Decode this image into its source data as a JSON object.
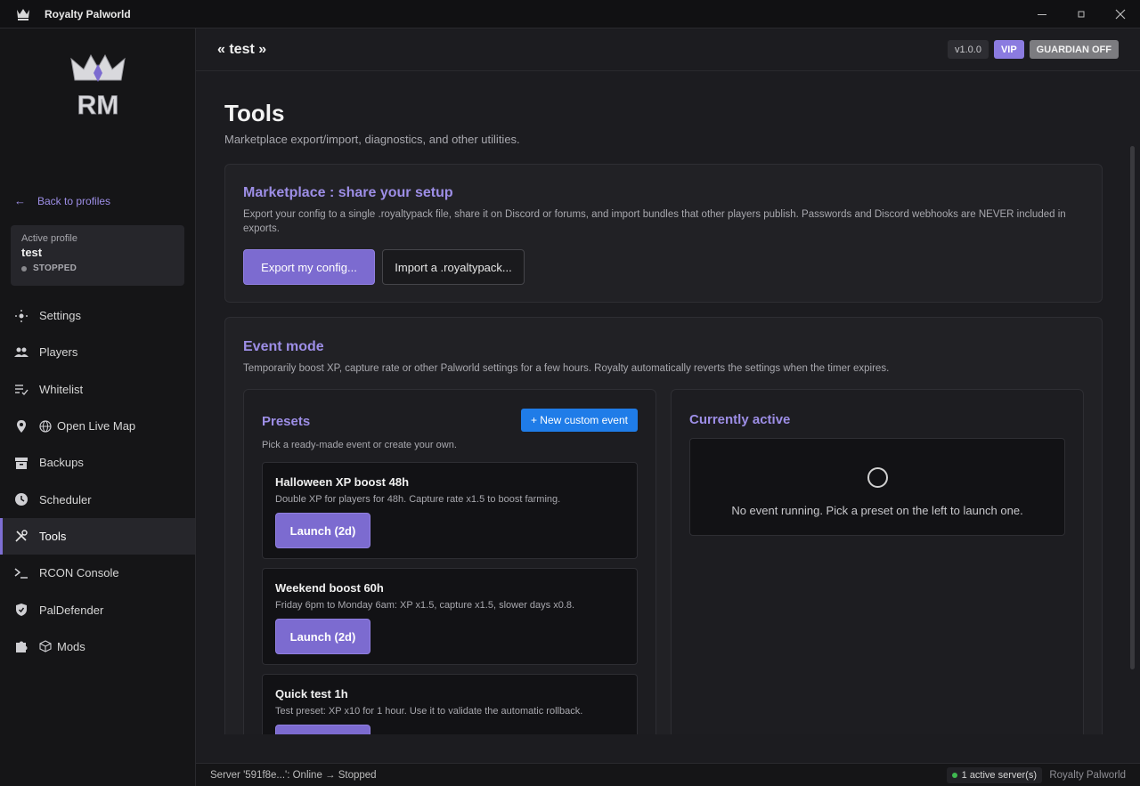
{
  "window": {
    "title": "Royalty Palworld",
    "controls": [
      "minimize-icon",
      "maximize-icon",
      "close-icon"
    ]
  },
  "sidebar": {
    "logo_text": "RM",
    "back_label": "Back to profiles",
    "profile": {
      "label": "Active profile",
      "name": "test",
      "status": "STOPPED"
    },
    "items": [
      {
        "label": "Settings",
        "icon": "settings-icon"
      },
      {
        "label": "Players",
        "icon": "users-icon"
      },
      {
        "label": "Whitelist",
        "icon": "checklist-icon"
      },
      {
        "label": "Open Live Map",
        "icon": "map-pin-icon"
      },
      {
        "label": "Backups",
        "icon": "archive-icon"
      },
      {
        "label": "Scheduler",
        "icon": "clock-icon"
      },
      {
        "label": "Tools",
        "icon": "tools-icon",
        "active": true
      },
      {
        "label": "RCON Console",
        "icon": "terminal-icon"
      },
      {
        "label": "PalDefender",
        "icon": "shield-icon"
      },
      {
        "label": "Mods",
        "icon": "puzzle-icon"
      }
    ]
  },
  "header": {
    "title": "« test »",
    "version": "v1.0.0",
    "vip": "VIP",
    "guardian": "GUARDIAN OFF"
  },
  "page": {
    "title": "Tools",
    "subtitle": "Marketplace export/import, diagnostics, and other utilities."
  },
  "marketplace": {
    "title": "Marketplace : share your setup",
    "description": "Export your config to a single .royaltypack file, share it on Discord or forums, and import bundles that other players publish. Passwords and Discord webhooks are NEVER included in exports.",
    "export_label": "Export my config...",
    "import_label": "Import a .royaltypack..."
  },
  "event_mode": {
    "title": "Event mode",
    "description": "Temporarily boost XP, capture rate or other Palworld settings for a few hours. Royalty automatically reverts the settings when the timer expires.",
    "presets": {
      "title": "Presets",
      "new_label": "+ New custom event",
      "hint": "Pick a ready-made event or create your own.",
      "items": [
        {
          "name": "Halloween XP boost 48h",
          "description": "Double XP for players for 48h. Capture rate x1.5 to boost farming.",
          "launch_label": "Launch (2d)"
        },
        {
          "name": "Weekend boost 60h",
          "description": "Friday 6pm to Monday 6am: XP x1.5, capture x1.5, slower days x0.8.",
          "launch_label": "Launch (2d)"
        },
        {
          "name": "Quick test 1h",
          "description": "Test preset: XP x10 for 1 hour. Use it to validate the automatic rollback.",
          "launch_label": ""
        }
      ]
    },
    "active": {
      "title": "Currently active",
      "empty_message": "No event running. Pick a preset on the left to launch one."
    }
  },
  "statusbar": {
    "message": "Server '591f8e...': Online → Stopped",
    "servers": "1 active server(s)",
    "app_name": "Royalty Palworld"
  },
  "colors": {
    "accent": "#9d8ee6",
    "primary_button": "#7c6bd0",
    "new_event_button": "#1f7ce8",
    "online_dot": "#3fb950"
  }
}
